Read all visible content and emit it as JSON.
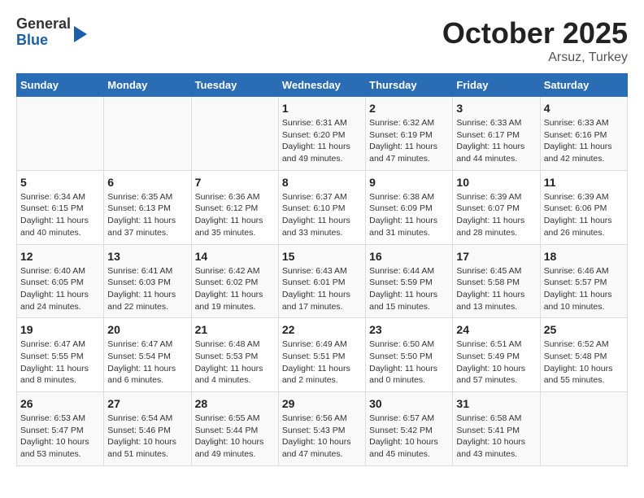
{
  "logo": {
    "general": "General",
    "blue": "Blue"
  },
  "header": {
    "month": "October 2025",
    "location": "Arsuz, Turkey"
  },
  "weekdays": [
    "Sunday",
    "Monday",
    "Tuesday",
    "Wednesday",
    "Thursday",
    "Friday",
    "Saturday"
  ],
  "weeks": [
    [
      {
        "day": "",
        "info": ""
      },
      {
        "day": "",
        "info": ""
      },
      {
        "day": "",
        "info": ""
      },
      {
        "day": "1",
        "info": "Sunrise: 6:31 AM\nSunset: 6:20 PM\nDaylight: 11 hours and 49 minutes."
      },
      {
        "day": "2",
        "info": "Sunrise: 6:32 AM\nSunset: 6:19 PM\nDaylight: 11 hours and 47 minutes."
      },
      {
        "day": "3",
        "info": "Sunrise: 6:33 AM\nSunset: 6:17 PM\nDaylight: 11 hours and 44 minutes."
      },
      {
        "day": "4",
        "info": "Sunrise: 6:33 AM\nSunset: 6:16 PM\nDaylight: 11 hours and 42 minutes."
      }
    ],
    [
      {
        "day": "5",
        "info": "Sunrise: 6:34 AM\nSunset: 6:15 PM\nDaylight: 11 hours and 40 minutes."
      },
      {
        "day": "6",
        "info": "Sunrise: 6:35 AM\nSunset: 6:13 PM\nDaylight: 11 hours and 37 minutes."
      },
      {
        "day": "7",
        "info": "Sunrise: 6:36 AM\nSunset: 6:12 PM\nDaylight: 11 hours and 35 minutes."
      },
      {
        "day": "8",
        "info": "Sunrise: 6:37 AM\nSunset: 6:10 PM\nDaylight: 11 hours and 33 minutes."
      },
      {
        "day": "9",
        "info": "Sunrise: 6:38 AM\nSunset: 6:09 PM\nDaylight: 11 hours and 31 minutes."
      },
      {
        "day": "10",
        "info": "Sunrise: 6:39 AM\nSunset: 6:07 PM\nDaylight: 11 hours and 28 minutes."
      },
      {
        "day": "11",
        "info": "Sunrise: 6:39 AM\nSunset: 6:06 PM\nDaylight: 11 hours and 26 minutes."
      }
    ],
    [
      {
        "day": "12",
        "info": "Sunrise: 6:40 AM\nSunset: 6:05 PM\nDaylight: 11 hours and 24 minutes."
      },
      {
        "day": "13",
        "info": "Sunrise: 6:41 AM\nSunset: 6:03 PM\nDaylight: 11 hours and 22 minutes."
      },
      {
        "day": "14",
        "info": "Sunrise: 6:42 AM\nSunset: 6:02 PM\nDaylight: 11 hours and 19 minutes."
      },
      {
        "day": "15",
        "info": "Sunrise: 6:43 AM\nSunset: 6:01 PM\nDaylight: 11 hours and 17 minutes."
      },
      {
        "day": "16",
        "info": "Sunrise: 6:44 AM\nSunset: 5:59 PM\nDaylight: 11 hours and 15 minutes."
      },
      {
        "day": "17",
        "info": "Sunrise: 6:45 AM\nSunset: 5:58 PM\nDaylight: 11 hours and 13 minutes."
      },
      {
        "day": "18",
        "info": "Sunrise: 6:46 AM\nSunset: 5:57 PM\nDaylight: 11 hours and 10 minutes."
      }
    ],
    [
      {
        "day": "19",
        "info": "Sunrise: 6:47 AM\nSunset: 5:55 PM\nDaylight: 11 hours and 8 minutes."
      },
      {
        "day": "20",
        "info": "Sunrise: 6:47 AM\nSunset: 5:54 PM\nDaylight: 11 hours and 6 minutes."
      },
      {
        "day": "21",
        "info": "Sunrise: 6:48 AM\nSunset: 5:53 PM\nDaylight: 11 hours and 4 minutes."
      },
      {
        "day": "22",
        "info": "Sunrise: 6:49 AM\nSunset: 5:51 PM\nDaylight: 11 hours and 2 minutes."
      },
      {
        "day": "23",
        "info": "Sunrise: 6:50 AM\nSunset: 5:50 PM\nDaylight: 11 hours and 0 minutes."
      },
      {
        "day": "24",
        "info": "Sunrise: 6:51 AM\nSunset: 5:49 PM\nDaylight: 10 hours and 57 minutes."
      },
      {
        "day": "25",
        "info": "Sunrise: 6:52 AM\nSunset: 5:48 PM\nDaylight: 10 hours and 55 minutes."
      }
    ],
    [
      {
        "day": "26",
        "info": "Sunrise: 6:53 AM\nSunset: 5:47 PM\nDaylight: 10 hours and 53 minutes."
      },
      {
        "day": "27",
        "info": "Sunrise: 6:54 AM\nSunset: 5:46 PM\nDaylight: 10 hours and 51 minutes."
      },
      {
        "day": "28",
        "info": "Sunrise: 6:55 AM\nSunset: 5:44 PM\nDaylight: 10 hours and 49 minutes."
      },
      {
        "day": "29",
        "info": "Sunrise: 6:56 AM\nSunset: 5:43 PM\nDaylight: 10 hours and 47 minutes."
      },
      {
        "day": "30",
        "info": "Sunrise: 6:57 AM\nSunset: 5:42 PM\nDaylight: 10 hours and 45 minutes."
      },
      {
        "day": "31",
        "info": "Sunrise: 6:58 AM\nSunset: 5:41 PM\nDaylight: 10 hours and 43 minutes."
      },
      {
        "day": "",
        "info": ""
      }
    ]
  ]
}
